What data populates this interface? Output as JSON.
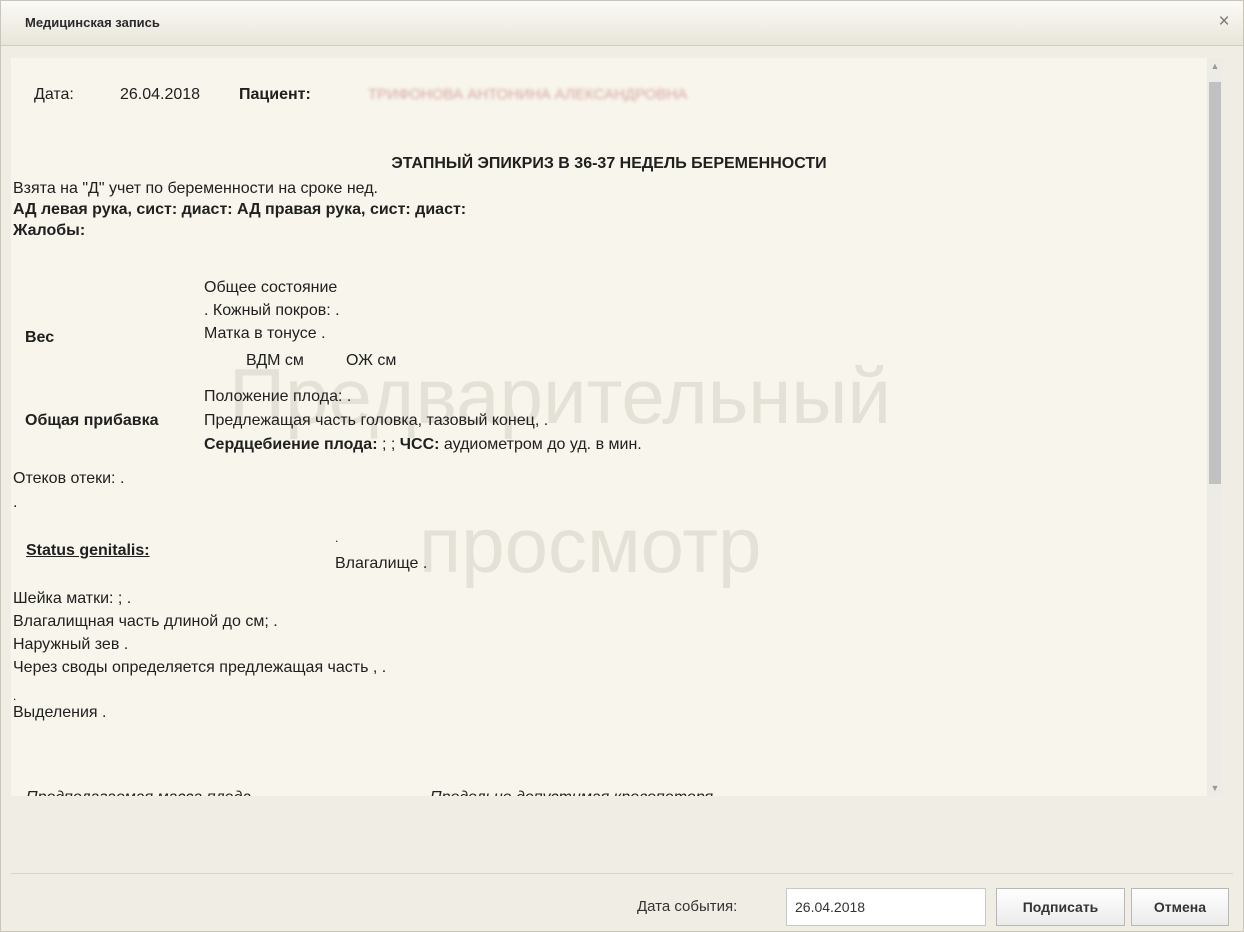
{
  "dialog": {
    "title": "Медицинская запись",
    "close_label": "×"
  },
  "watermark": {
    "line1": "Предварительный",
    "line2": "просмотр"
  },
  "doc": {
    "date_label": "Дата:",
    "date_value": "26.04.2018",
    "patient_label": "Пациент:",
    "patient_value": "ТРИФОНОВА АНТОНИНА АЛЕКСАНДРОВНА",
    "heading": "ЭТАПНЫЙ ЭПИКРИЗ В 36-37 НЕДЕЛЬ БЕРЕМЕННОСТИ",
    "line_registered": "Взята на \"Д\" учет по беременности на сроке нед.",
    "bp_line": "АД левая рука, сист:  диаст:  АД правая рука, сист:  диаст:",
    "complaints": "Жалобы:",
    "weight": "Вес",
    "general_state": "Общее состояние",
    "skin": ". Кожный покров: .",
    "uterus_tone": "Матка в тонусе .",
    "vdm": "ВДМ см",
    "ozh": "ОЖ см",
    "fetus_position": "Положение плода: .",
    "total_gain": "Общая прибавка",
    "presenting_part": "Предлежащая часть головка, тазовый конец, .",
    "heartbeat_label": "Сердцебиение плода:",
    "heartbeat_value": " ; ;",
    "chss_label": "ЧСС:",
    "chss_value": " аудиометром до уд. в мин.",
    "edema": "Отеков отеки: .",
    "dot1": ".",
    "status_genitalis": "Status genitalis:",
    "dot2": ".",
    "vagina": "Влагалище .",
    "cervix": "Шейка матки: ; .",
    "vaginal_part": "Влагалищная часть длиной до см; .",
    "external_os": "Наружный зев .",
    "vaults": "Через своды определяется предлежащая часть , .",
    "dot3": ".",
    "discharge": "Выделения .",
    "estimated_mass": "Предполагаемая масса плода",
    "blood_loss": "Предельно допустимая кровопотеря"
  },
  "footer": {
    "event_date_label": "Дата события:",
    "event_date_value": "26.04.2018",
    "sign_button": "Подписать",
    "cancel_button": "Отмена"
  }
}
